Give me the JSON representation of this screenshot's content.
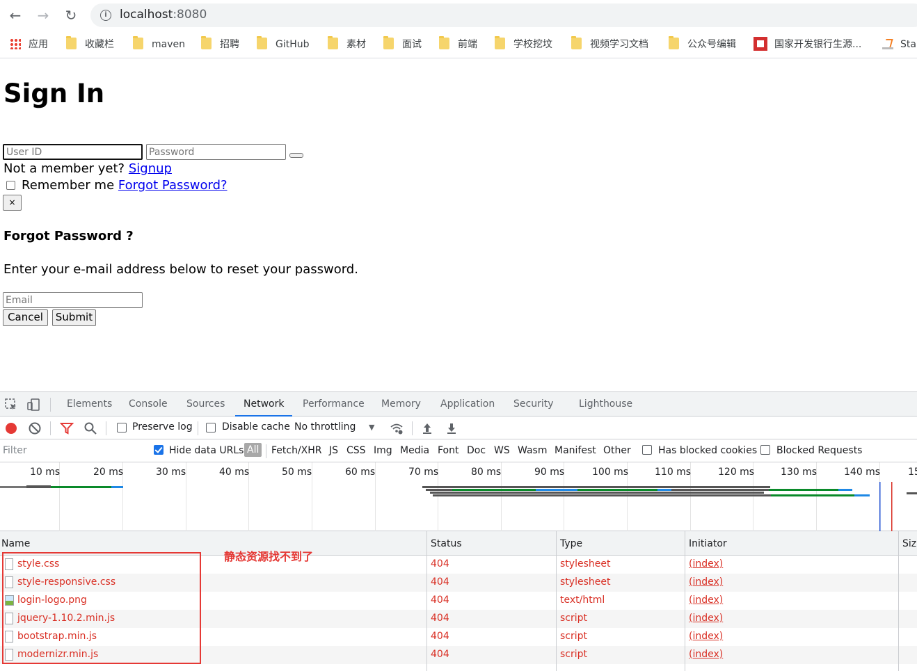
{
  "browser": {
    "url_host": "localhost",
    "url_port": ":8080",
    "back_icon": "arrow-left-icon",
    "forward_icon": "arrow-right-icon",
    "reload_icon": "reload-icon"
  },
  "bookmarks": [
    {
      "label": "应用",
      "icon": "apps-grid-icon"
    },
    {
      "label": "收藏栏",
      "icon": "folder-icon"
    },
    {
      "label": "maven",
      "icon": "folder-icon"
    },
    {
      "label": "招聘",
      "icon": "folder-icon"
    },
    {
      "label": "GitHub",
      "icon": "folder-icon"
    },
    {
      "label": "素材",
      "icon": "folder-icon"
    },
    {
      "label": "面试",
      "icon": "folder-icon"
    },
    {
      "label": "前端",
      "icon": "folder-icon"
    },
    {
      "label": "学校挖坟",
      "icon": "folder-icon"
    },
    {
      "label": "视频学习文档",
      "icon": "folder-icon"
    },
    {
      "label": "公众号编辑",
      "icon": "folder-icon"
    },
    {
      "label": "国家开发银行生源...",
      "icon": "cdb-logo-icon"
    },
    {
      "label": "Sta",
      "icon": "stackoverflow-icon"
    }
  ],
  "signin": {
    "title": "Sign In",
    "userid_placeholder": "User ID",
    "password_placeholder": "Password",
    "not_member": "Not a member yet?",
    "signup_link": "Signup",
    "remember_me": "Remember me",
    "forgot_link": "Forgot Password?",
    "close_button": "×"
  },
  "forgot": {
    "heading": "Forgot Password ?",
    "description": "Enter your e-mail address below to reset your password.",
    "email_placeholder": "Email",
    "cancel": "Cancel",
    "submit": "Submit"
  },
  "devtools": {
    "tabs": [
      "Elements",
      "Console",
      "Sources",
      "Network",
      "Performance",
      "Memory",
      "Application",
      "Security",
      "Lighthouse"
    ],
    "active_tab": "Network",
    "toolbar": {
      "preserve_log": "Preserve log",
      "disable_cache": "Disable cache",
      "throttling": "No throttling"
    },
    "filter": {
      "placeholder": "Filter",
      "hide_data_urls": "Hide data URLs",
      "types": [
        "All",
        "Fetch/XHR",
        "JS",
        "CSS",
        "Img",
        "Media",
        "Font",
        "Doc",
        "WS",
        "Wasm",
        "Manifest",
        "Other"
      ],
      "has_blocked_cookies": "Has blocked cookies",
      "blocked_requests": "Blocked Requests"
    },
    "timeline_ticks": [
      "10 ms",
      "20 ms",
      "30 ms",
      "40 ms",
      "50 ms",
      "60 ms",
      "70 ms",
      "80 ms",
      "90 ms",
      "100 ms",
      "110 ms",
      "120 ms",
      "130 ms",
      "140 ms",
      "15"
    ],
    "columns": {
      "name": "Name",
      "status": "Status",
      "type": "Type",
      "initiator": "Initiator",
      "size": "Siz"
    },
    "requests": [
      {
        "name": "style.css",
        "status": "404",
        "type": "stylesheet",
        "initiator": "(index)",
        "icon": "file-icon"
      },
      {
        "name": "style-responsive.css",
        "status": "404",
        "type": "stylesheet",
        "initiator": "(index)",
        "icon": "file-icon"
      },
      {
        "name": "login-logo.png",
        "status": "404",
        "type": "text/html",
        "initiator": "(index)",
        "icon": "image-icon"
      },
      {
        "name": "jquery-1.10.2.min.js",
        "status": "404",
        "type": "script",
        "initiator": "(index)",
        "icon": "file-icon"
      },
      {
        "name": "bootstrap.min.js",
        "status": "404",
        "type": "script",
        "initiator": "(index)",
        "icon": "file-icon"
      },
      {
        "name": "modernizr.min.js",
        "status": "404",
        "type": "script",
        "initiator": "(index)",
        "icon": "file-icon"
      }
    ]
  },
  "annotation": "静态资源找不到了",
  "colors": {
    "error": "#d93025",
    "link": "#0000ee",
    "accent": "#1a73e8",
    "annotation": "#e53935"
  }
}
